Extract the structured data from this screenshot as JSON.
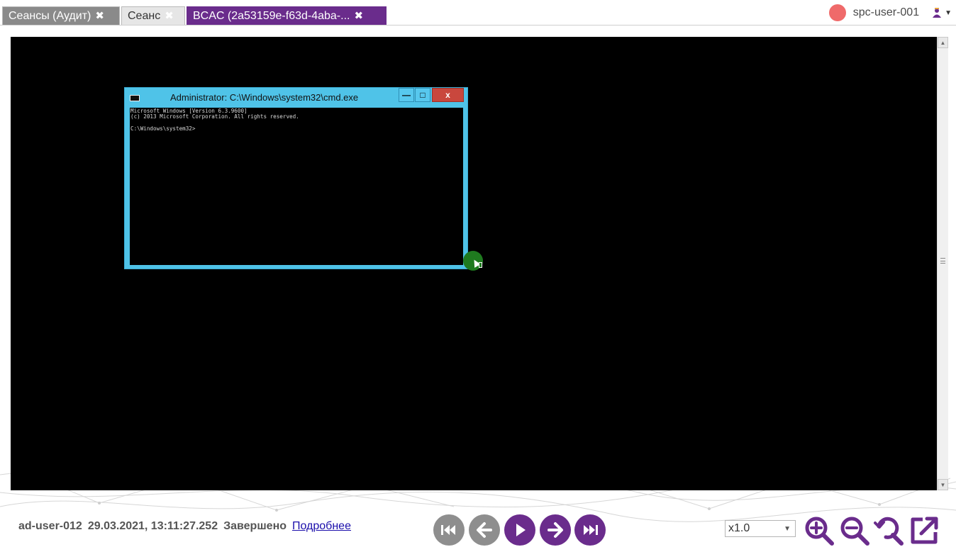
{
  "tabs": [
    {
      "label": "Сеансы (Аудит)",
      "close": "✖"
    },
    {
      "label": "Сеанс",
      "close": "✖"
    },
    {
      "label": "BCAC (2a53159e-f63d-4aba-...",
      "close": "✖"
    }
  ],
  "user": {
    "name": "spc-user-001"
  },
  "cmd": {
    "title": "Administrator: C:\\Windows\\system32\\cmd.exe",
    "buttons": {
      "minimize": "—",
      "maximize": "□",
      "close": "x"
    },
    "output": "Microsoft Windows [Version 6.3.9600]\n(c) 2013 Microsoft Corporation. All rights reserved.\n\nC:\\Windows\\system32>"
  },
  "info": {
    "user": "ad-user-012",
    "datetime": "29.03.2021, 13:11:27.252",
    "status": "Завершено",
    "details_link": "Подробнее"
  },
  "playback": {
    "speed": "x1.0",
    "controls": [
      "first-frame-icon",
      "previous-icon",
      "play-icon",
      "next-icon",
      "last-frame-icon"
    ]
  },
  "tools": [
    "zoom-in-icon",
    "zoom-out-icon",
    "zoom-fit-icon",
    "popout-icon"
  ],
  "colors": {
    "accent": "#6a2c8c",
    "inactive_control": "#8e8e8e",
    "cmd_frame": "#4fc3e8",
    "cmd_close": "#c9473d",
    "user_status": "#ef6a6a"
  }
}
